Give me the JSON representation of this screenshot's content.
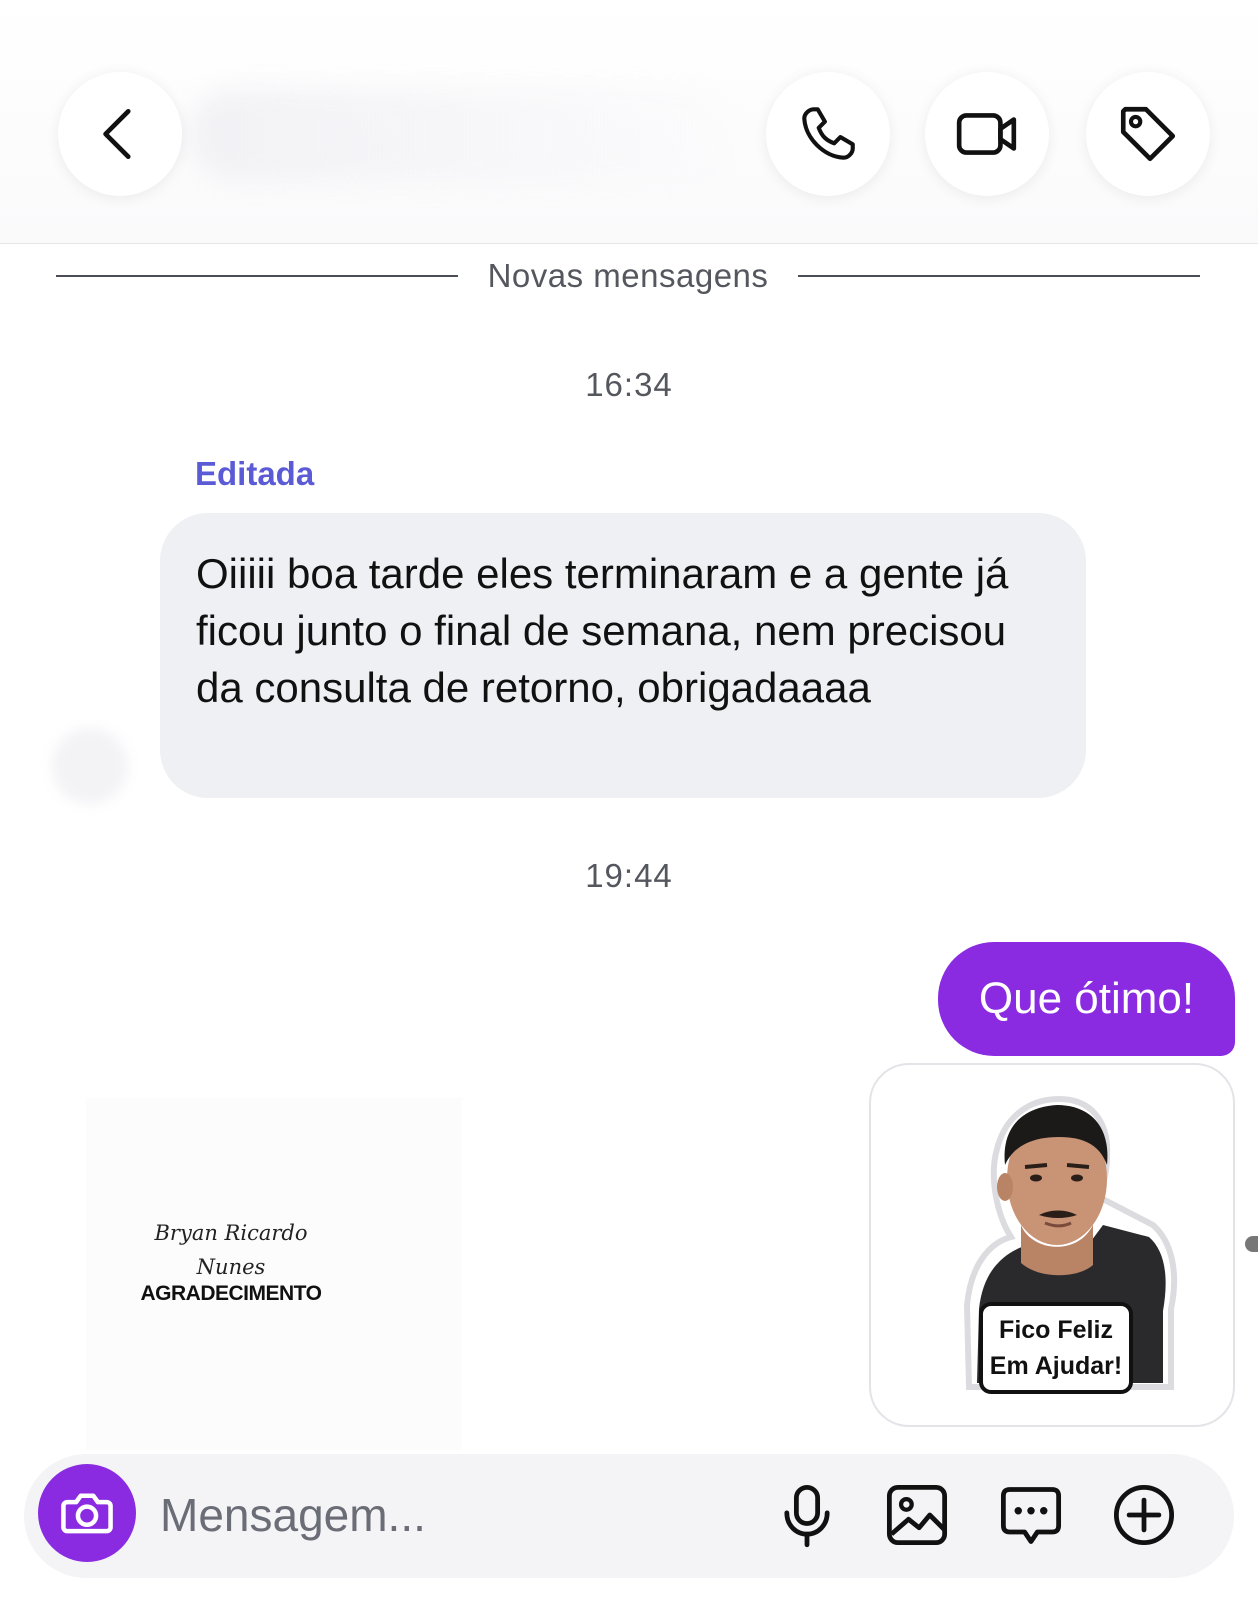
{
  "header": {
    "back_icon": "chevron-left-icon",
    "call_icon": "phone-icon",
    "video_icon": "video-camera-icon",
    "tag_icon": "tag-icon"
  },
  "divider": {
    "label": "Novas mensagens"
  },
  "messages": [
    {
      "timestamp": "16:34",
      "edited_label": "Editada",
      "text": "Oiiiii boa tarde eles terminaram e a gente já ficou junto o final de semana, nem precisou da consulta de retorno, obrigadaaaa",
      "direction": "incoming"
    },
    {
      "timestamp": "19:44",
      "text": "Que ótimo!",
      "direction": "outgoing"
    }
  ],
  "attachment": {
    "sign_line1": "Bryan Ricardo",
    "sign_line2": "Nunes",
    "title": "AGRADECIMENTO"
  },
  "sticker": {
    "caption_line1": "Fico Feliz",
    "caption_line2": "Em Ajudar!"
  },
  "composer": {
    "placeholder": "Mensagem...",
    "camera_icon": "camera-icon",
    "mic_icon": "microphone-icon",
    "gallery_icon": "image-icon",
    "sticker_icon": "chat-bubble-icon",
    "plus_icon": "plus-circle-icon"
  },
  "colors": {
    "accent": "#8a2be2",
    "edited": "#5b5bd6",
    "incoming_bubble": "#eef0f4",
    "text_secondary": "#55575f"
  }
}
